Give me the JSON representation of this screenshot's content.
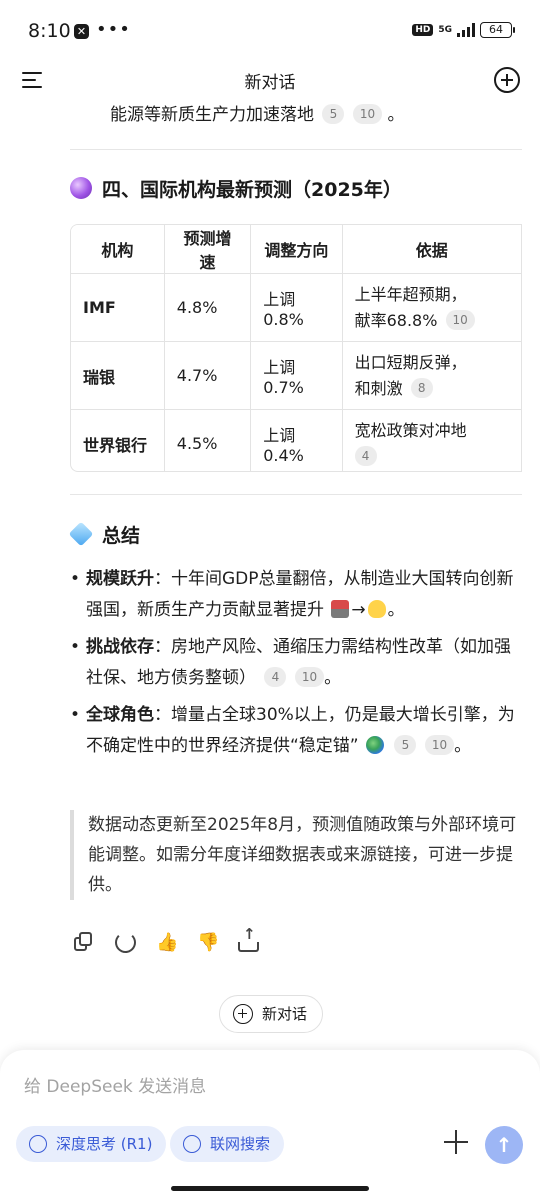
{
  "status": {
    "time": "8:10",
    "hd": "HD",
    "network": "5G",
    "battery": "64"
  },
  "header": {
    "title": "新对话"
  },
  "lead": {
    "text": "能源等新质生产力加速落地",
    "cites": [
      "5",
      "10"
    ],
    "tail": "。"
  },
  "section4": {
    "title": "四、国际机构最新预测（2025年）",
    "table": {
      "headers": [
        "机构",
        "预测增速",
        "调整方向",
        "依据"
      ],
      "rows": [
        {
          "org": "IMF",
          "growth": "4.8%",
          "adjust": "上调0.8%",
          "basis1": "上半年超预期，",
          "basis2": "献率68.8%",
          "cite": "10"
        },
        {
          "org": "瑞银",
          "growth": "4.7%",
          "adjust": "上调0.7%",
          "basis1": "出口短期反弹，",
          "basis2": "和刺激",
          "cite": "8"
        },
        {
          "org": "世界银行",
          "growth": "4.5%",
          "adjust": "上调0.4%",
          "basis1": "宽松政策对冲地",
          "basis2": "",
          "cite": "4"
        }
      ]
    }
  },
  "summary": {
    "title": "总结",
    "bullets": [
      {
        "label": "规模跃升",
        "text": "：十年间GDP总量翻倍，从制造业大国转向创新强国，新质生产力贡献显著提升 ",
        "arrow": "→",
        "tail": "。"
      },
      {
        "label": "挑战依存",
        "text": "：房地产风险、通缩压力需结构性改革（如加强社保、地方债务整顿）",
        "cites": [
          "4",
          "10"
        ],
        "tail": "。"
      },
      {
        "label": "全球角色",
        "text": "：增量占全球30%以上，仍是最大增长引擎，为不确定性中的世界经济提供“稳定锚” ",
        "cites": [
          "5",
          "10"
        ],
        "tail": "。"
      }
    ]
  },
  "quote": "数据动态更新至2025年8月，预测值随政策与外部环境可能调整。如需分年度详细数据表或来源链接，可进一步提供。",
  "new_chat_button": "新对话",
  "composer": {
    "placeholder": "给 DeepSeek 发送消息",
    "deep_think": "深度思考 (R1)",
    "web_search": "联网搜索"
  },
  "colors": {
    "accent": "#3a5bd6",
    "chip_bg": "#e8eefc",
    "send_bg": "#9db6f5"
  }
}
